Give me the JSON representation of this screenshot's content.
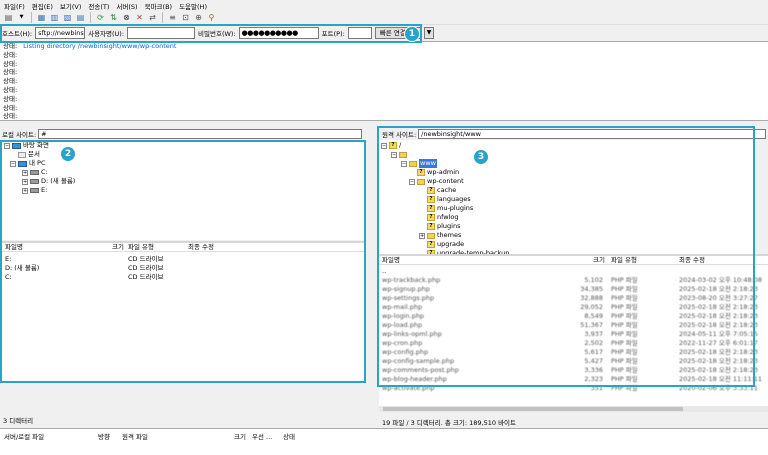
{
  "menu": [
    "파일(F)",
    "편집(E)",
    "보기(V)",
    "전송(T)",
    "서버(S)",
    "북마크(B)",
    "도움말(H)"
  ],
  "quickconnect": {
    "host_label": "호스트(H):",
    "host_value": "sftp://newbinsight.",
    "user_label": "사용자명(U):",
    "user_value": "",
    "pass_label": "비밀번호(W):",
    "pass_value": "●●●●●●●●●●",
    "port_label": "포트(P):",
    "port_value": "",
    "connect_label": "빠른 연결(Q)",
    "dropdown": "▼"
  },
  "callouts": [
    "1",
    "2",
    "3"
  ],
  "log": {
    "first_label": "상태:",
    "first_msg": "Listing directory /newbinsight/www/wp-content",
    "rows": [
      "상태:",
      "상태:",
      "상태:",
      "상태:",
      "상태:",
      "상태:",
      "상태:",
      "상태:"
    ]
  },
  "local": {
    "site_label": "로컬 사이트:",
    "site_value": "#",
    "tree": [
      "바탕 화면",
      "문서",
      "내 PC",
      "C:",
      "D: (새 볼륨)",
      "E:"
    ],
    "headers": [
      "파일명",
      "크기",
      "파일 유형",
      "최종 수정"
    ],
    "files": [
      {
        "name": "E:",
        "type": "CD 드라이브"
      },
      {
        "name": "D: (새 볼륨)",
        "type": "CD 드라이브"
      },
      {
        "name": "C:",
        "type": "CD 드라이브"
      }
    ],
    "status": "3 디렉터리"
  },
  "remote": {
    "site_label": "원격 사이트:",
    "site_value": "/newbinsight/www",
    "tree": [
      "/",
      "",
      "www",
      "wp-admin",
      "wp-content",
      "cache",
      "languages",
      "mu-plugins",
      "nfwlog",
      "plugins",
      "themes",
      "upgrade",
      "upgrade-temp-backup"
    ],
    "headers": [
      "파일명",
      "크기",
      "파일 유형",
      "최종 수정"
    ],
    "files": [
      {
        "name": "..",
        "size": "",
        "type": "",
        "date": ""
      },
      {
        "name": "wp-trackback.php",
        "size": "5,102",
        "type": "PHP 파일",
        "date": "2024-03-02 오후 10:48:08"
      },
      {
        "name": "wp-signup.php",
        "size": "34,385",
        "type": "PHP 파일",
        "date": "2025-02-18 오전 2:18:23"
      },
      {
        "name": "wp-settings.php",
        "size": "32,888",
        "type": "PHP 파일",
        "date": "2023-08-20 오전 3:27:27"
      },
      {
        "name": "wp-mail.php",
        "size": "29,052",
        "type": "PHP 파일",
        "date": "2025-02-18 오전 2:18:23"
      },
      {
        "name": "wp-login.php",
        "size": "8,549",
        "type": "PHP 파일",
        "date": "2025-02-18 오전 2:18:23"
      },
      {
        "name": "wp-load.php",
        "size": "51,367",
        "type": "PHP 파일",
        "date": "2025-02-18 오전 2:18:23"
      },
      {
        "name": "wp-links-opml.php",
        "size": "3,937",
        "type": "PHP 파일",
        "date": "2024-05-11 오후 7:05:15"
      },
      {
        "name": "wp-cron.php",
        "size": "2,502",
        "type": "PHP 파일",
        "date": "2022-11-27 오후 6:01:17"
      },
      {
        "name": "wp-config.php",
        "size": "5,617",
        "type": "PHP 파일",
        "date": "2025-02-18 오전 2:18:23"
      },
      {
        "name": "wp-config-sample.php",
        "size": "5,427",
        "type": "PHP 파일",
        "date": "2025-02-18 오전 2:18:23"
      },
      {
        "name": "wp-comments-post.php",
        "size": "3,336",
        "type": "PHP 파일",
        "date": "2025-02-18 오전 2:18:23"
      },
      {
        "name": "wp-blog-header.php",
        "size": "2,323",
        "type": "PHP 파일",
        "date": "2025-02-18 오전 11:11:11"
      },
      {
        "name": "wp-activate.php",
        "size": "351",
        "type": "PHP 파일",
        "date": "2020-02-06 오후 3:33:11"
      }
    ],
    "status": "19 파일 / 3 디렉터리. 총 크기: 189,510 바이트"
  },
  "queue": {
    "headers": [
      "서버/로컬 파일",
      "방향",
      "원격 파일",
      "크기",
      "우선 ...",
      "상태"
    ]
  }
}
